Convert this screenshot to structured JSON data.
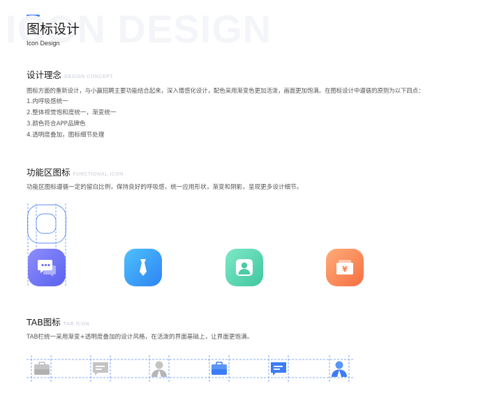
{
  "header": {
    "watermark": "ICON DESIGN",
    "title": "图标设计",
    "subtitle": "Icon Design"
  },
  "concept": {
    "title": "设计理念",
    "en": "DESIGN CONCEPT",
    "paragraph": "图标方面的重新设计，与小赢招聘主要功能结合起来，深入情感化设计，配色采用渐变色更加活泼，画面更加饱满。在图标设计中遵循的原则为以下四点：",
    "points": [
      "1.内呼吸感统一",
      "2.整体视觉饱和度统一，渐变统一",
      "3.颜色符合APP品牌色",
      "4.透明度叠加，图标细节处理"
    ]
  },
  "functional": {
    "title": "功能区图标",
    "en": "FUNCTIONAL ICON",
    "paragraph": "功能区图标遵循一定的留白比例，保持良好的呼吸感，统一应用形状，渐变和阴影，呈现更多设计细节。",
    "icons": [
      {
        "icon": "chat-bubble-icon",
        "color_from": "#8d8dfb",
        "color_to": "#5a62ef"
      },
      {
        "icon": "necktie-icon",
        "color_from": "#4fc0fb",
        "color_to": "#2c84f4"
      },
      {
        "icon": "user-icon",
        "color_from": "#7ee8c6",
        "color_to": "#40c7a0"
      },
      {
        "icon": "yuan-wallet-icon",
        "color_from": "#fdac78",
        "color_to": "#f66f42",
        "symbol": "¥"
      }
    ]
  },
  "tab": {
    "title": "TAB图标",
    "en": "TAB ICON",
    "paragraph": "TAB栏统一采用渐变+透明度叠加的设计风格，在活泼的界面基础上，让界面更饱满。",
    "icons": [
      {
        "icon": "briefcase-icon",
        "state": "inactive"
      },
      {
        "icon": "message-icon",
        "state": "inactive"
      },
      {
        "icon": "person-icon",
        "state": "inactive"
      },
      {
        "icon": "briefcase-icon",
        "state": "active"
      },
      {
        "icon": "message-icon",
        "state": "active"
      },
      {
        "icon": "person-icon",
        "state": "active"
      }
    ]
  },
  "colors": {
    "accent": "#3c7cf6",
    "guide": "#5b8df5",
    "inactive": "#c4c4c4",
    "active": "#3c7cf6"
  }
}
